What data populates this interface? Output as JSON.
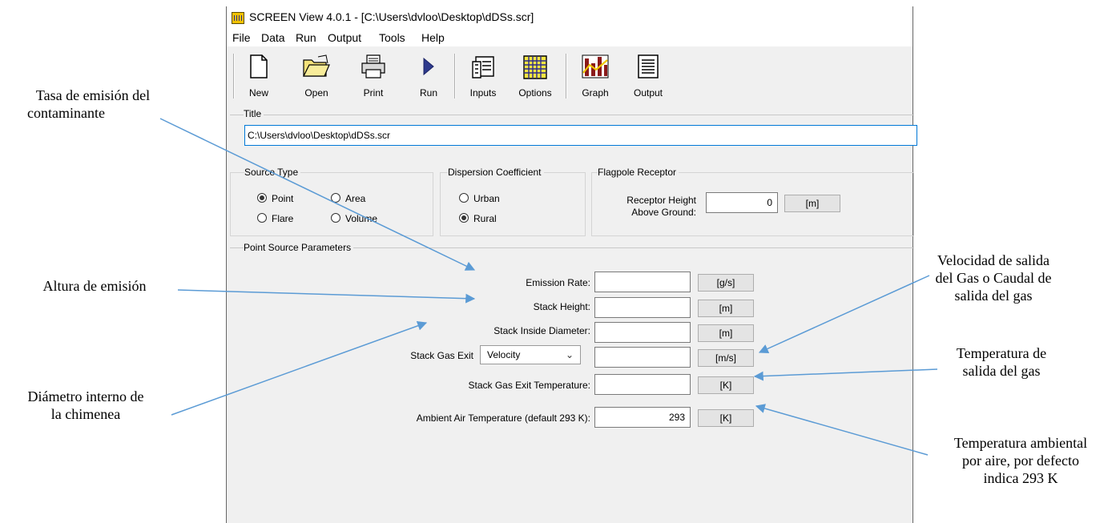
{
  "window": {
    "title": "SCREEN View 4.0.1 - [C:\\Users\\dvloo\\Desktop\\dDSs.scr]",
    "menu": [
      "File",
      "Data",
      "Run",
      "Output",
      "Tools",
      "Help"
    ],
    "toolbar": [
      "New",
      "Open",
      "Print",
      "Run",
      "Inputs",
      "Options",
      "Graph",
      "Output"
    ]
  },
  "title_section": {
    "label": "Title",
    "value": "C:\\Users\\dvloo\\Desktop\\dDSs.scr"
  },
  "source_type": {
    "label": "Source Type",
    "options": [
      "Point",
      "Area",
      "Flare",
      "Volume"
    ],
    "selected": "Point"
  },
  "dispersion": {
    "label": "Dispersion Coefficient",
    "options": [
      "Urban",
      "Rural"
    ],
    "selected": "Rural"
  },
  "flagpole": {
    "label": "Flagpole Receptor",
    "field_line1": "Receptor Height",
    "field_line2": "Above Ground:",
    "value": "0",
    "unit": "[m]"
  },
  "point_source": {
    "label": "Point Source Parameters",
    "fields": [
      {
        "label": "Emission Rate:",
        "value": "",
        "unit": "[g/s]"
      },
      {
        "label": "Stack Height:",
        "value": "",
        "unit": "[m]"
      },
      {
        "label": "Stack Inside Diameter:",
        "value": "",
        "unit": "[m]"
      },
      {
        "label": "Stack Gas Exit",
        "select": "Velocity",
        "value": "",
        "unit": "[m/s]"
      },
      {
        "label": "Stack Gas Exit Temperature:",
        "value": "",
        "unit": "[K]"
      },
      {
        "label": "Ambient Air Temperature (default 293 K):",
        "value": "293",
        "unit": "[K]"
      }
    ]
  },
  "annotations": {
    "emission_rate": [
      "Tasa de emisión del",
      "contaminante"
    ],
    "stack_height": [
      "Altura de emisión"
    ],
    "diameter": [
      "Diámetro interno de",
      "la chimenea"
    ],
    "velocity": [
      "Velocidad de salida",
      "del Gas o Caudal de",
      "salida del gas"
    ],
    "exit_temp": [
      "Temperatura de",
      "salida del gas"
    ],
    "ambient_temp": [
      "Temperatura ambiental",
      "por aire, por defecto",
      "indica 293 K"
    ]
  },
  "colors": {
    "arrow": "#5b9bd5",
    "focus_border": "#0078d7",
    "window_bg": "#f0f0f0"
  }
}
